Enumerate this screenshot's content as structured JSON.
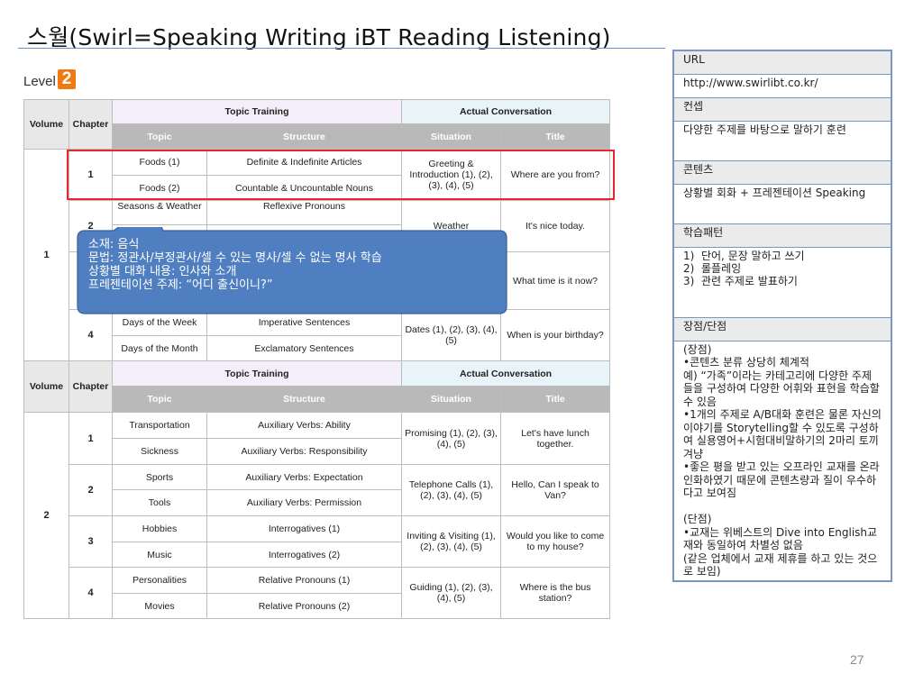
{
  "slide": {
    "title": "스월(Swirl=Speaking Writing iBT Reading Listening)",
    "level_label": "Level",
    "level_number": "2",
    "page_number": "27"
  },
  "table1": {
    "h_volume": "Volume",
    "h_chapter": "Chapter",
    "h_topic_training": "Topic Training",
    "h_actual": "Actual Conversation",
    "h_topic": "Topic",
    "h_structure": "Structure",
    "h_situation": "Situation",
    "h_title": "Title",
    "volume": "1",
    "ch1": "1",
    "ch2": "2",
    "ch4": "4",
    "rows": [
      {
        "topic": "Foods (1)",
        "structure": "Definite & Indefinite Articles"
      },
      {
        "topic": "Foods (2)",
        "structure": "Countable & Uncountable Nouns"
      },
      {
        "topic": "Seasons & Weather",
        "structure": "Reflexive Pronouns"
      },
      {
        "topic": "Days of the Week",
        "structure": "Imperative Sentences"
      },
      {
        "topic": "Days of the Month",
        "structure": "Exclamatory Sentences"
      }
    ],
    "sit1": "Greeting & Introduction (1), (2), (3), (4), (5)",
    "title1": "Where are you from?",
    "sit2": "Weather",
    "title2": "It's nice today.",
    "title3": "What time is it now?",
    "sit4": "Dates (1), (2), (3), (4), (5)",
    "title4": "When is your birthday?"
  },
  "table2": {
    "h_volume": "Volume",
    "h_chapter": "Chapter",
    "h_topic_training": "Topic Training",
    "h_actual": "Actual Conversation",
    "h_topic": "Topic",
    "h_structure": "Structure",
    "h_situation": "Situation",
    "h_title": "Title",
    "volume": "2",
    "chapters": [
      {
        "num": "1",
        "rows": [
          {
            "topic": "Transportation",
            "structure": "Auxiliary Verbs: Ability"
          },
          {
            "topic": "Sickness",
            "structure": "Auxiliary Verbs: Responsibility"
          }
        ],
        "situation": "Promising (1), (2), (3), (4), (5)",
        "title": "Let's have lunch together."
      },
      {
        "num": "2",
        "rows": [
          {
            "topic": "Sports",
            "structure": "Auxiliary Verbs: Expectation"
          },
          {
            "topic": "Tools",
            "structure": "Auxiliary Verbs: Permission"
          }
        ],
        "situation": "Telephone Calls (1), (2), (3), (4), (5)",
        "title": "Hello, Can I speak to Van?"
      },
      {
        "num": "3",
        "rows": [
          {
            "topic": "Hobbies",
            "structure": "Interrogatives (1)"
          },
          {
            "topic": "Music",
            "structure": "Interrogatives (2)"
          }
        ],
        "situation": "Inviting & Visiting (1), (2), (3), (4), (5)",
        "title": "Would you like to come to my house?"
      },
      {
        "num": "4",
        "rows": [
          {
            "topic": "Personalities",
            "structure": "Relative Pronouns (1)"
          },
          {
            "topic": "Movies",
            "structure": "Relative Pronouns (2)"
          }
        ],
        "situation": "Guiding (1), (2), (3), (4), (5)",
        "title": "Where is the bus station?"
      }
    ]
  },
  "callout": {
    "line1": "소재: 음식",
    "line2": "문법: 정관사/부정관사/셀 수 있는 명사/셀 수 없는 명사 학습",
    "line3": "상황별 대화 내용: 인사와 소개",
    "line4": "프레젠테이션 주제: “어디 출신이니?”"
  },
  "info": {
    "url_label": "URL",
    "url_value": "http://www.swirlibt.co.kr/",
    "concept_label": "컨셉",
    "concept_value": "다양한 주제를 바탕으로 말하기 훈련",
    "contents_label": "콘텐츠",
    "contents_value": "상황별 회화 + 프레젠테이션 Speaking",
    "pattern_label": "학습패턴",
    "pattern_value": "1)  단어, 문장 말하고 쓰기\n2)  롤플레잉\n3)  관련 주제로 발표하기",
    "proscons_label": "장점/단점",
    "proscons_value": "(장점)\n•콘텐츠 분류 상당히 체계적\n예) “가족”이라는 카테고리에 다양한 주제들을 구성하여 다양한 어휘와 표현을 학습할 수 있음\n•1개의 주제로 A/B대화 훈련은 물론 자신의 이야기를 Storytelling할 수 있도록 구성하여 실용영어+시험대비말하기의 2마리 토끼 겨냥\n•좋은 평을 받고 있는 오프라인 교재를 온라인화하였기 때문에 콘텐츠량과 질이 우수하다고 보여짐\n\n(단점)\n•교재는 위베스트의 Dive into English교재와 동일하여 차별성 없음\n(같은 업체에서 교재 제휴를 하고 있는 것으로 보임)"
  },
  "colors": {
    "callout_fill": "#4f7fc0",
    "callout_border": "#3a5f93",
    "highlight": "#e8262c",
    "badge": "#f07a10",
    "info_border": "#7a96c4"
  }
}
